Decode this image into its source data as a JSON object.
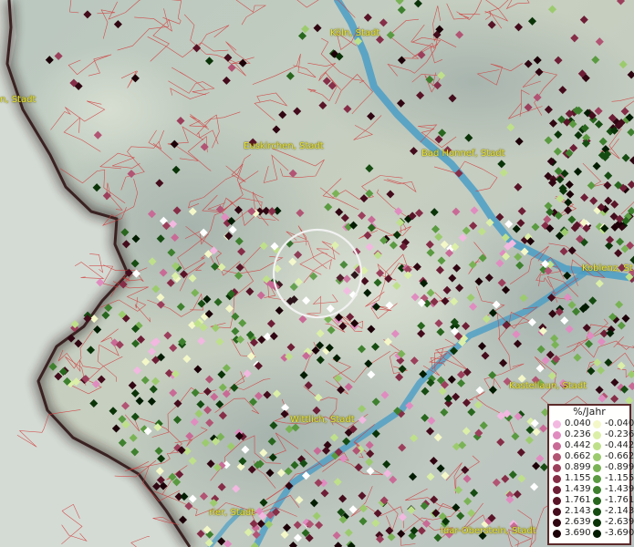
{
  "cities": [
    {
      "name": "Köln, Stadt"
    },
    {
      "name": "Bad Honnef, Stadt"
    },
    {
      "name": "Euskirchen, Stadt"
    },
    {
      "name": "Koblenz, St"
    },
    {
      "name": "Kastellaun, Stadt"
    },
    {
      "name": "Wittlich, Stadt"
    },
    {
      "name": "Idar-Oberstein, Stadt"
    },
    {
      "name": "rier, Stadt"
    },
    {
      "name": "n, Stadt"
    }
  ],
  "legend": {
    "title": "%/Jahr",
    "positive": [
      {
        "label": "0.040",
        "color": "#f2b8e0"
      },
      {
        "label": "0.236",
        "color": "#e08cc0"
      },
      {
        "label": "0.442",
        "color": "#c96a96"
      },
      {
        "label": "0.662",
        "color": "#b25474"
      },
      {
        "label": "0.899",
        "color": "#9c3f5c"
      },
      {
        "label": "1.155",
        "color": "#862d48"
      },
      {
        "label": "1.439",
        "color": "#6e1e36"
      },
      {
        "label": "1.761",
        "color": "#591428"
      },
      {
        "label": "2.143",
        "color": "#440c1c"
      },
      {
        "label": "2.639",
        "color": "#300612"
      },
      {
        "label": "3.690",
        "color": "#1c0208"
      }
    ],
    "negative": [
      {
        "label": "-0.040",
        "color": "#f4f8c8"
      },
      {
        "label": "-0.236",
        "color": "#dcefa8"
      },
      {
        "label": "-0.442",
        "color": "#bfe08a"
      },
      {
        "label": "-0.662",
        "color": "#9ccb6e"
      },
      {
        "label": "-0.899",
        "color": "#7ab356"
      },
      {
        "label": "-1.155",
        "color": "#5a9a40"
      },
      {
        "label": "-1.439",
        "color": "#3e802e"
      },
      {
        "label": "-1.761",
        "color": "#28661e"
      },
      {
        "label": "-2.143",
        "color": "#164c12"
      },
      {
        "label": "-2.639",
        "color": "#0a3408"
      },
      {
        "label": "-3.690",
        "color": "#021c02"
      }
    ]
  }
}
